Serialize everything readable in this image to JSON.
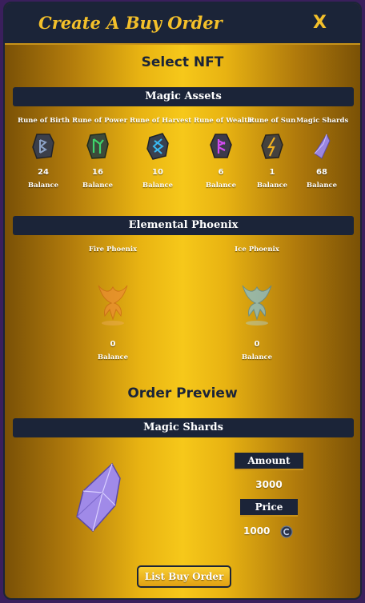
{
  "window": {
    "title": "Create A Buy Order",
    "close_label": "X"
  },
  "select_heading": "Select NFT",
  "magic_assets": {
    "title": "Magic Assets",
    "items": [
      {
        "label": "Rune of Birth",
        "count": "24",
        "balance": "Balance",
        "icon": "rune-of-birth-icon"
      },
      {
        "label": "Rune of Power",
        "count": "16",
        "balance": "Balance",
        "icon": "rune-of-power-icon"
      },
      {
        "label": "Rune of Harvest",
        "count": "10",
        "balance": "Balance",
        "icon": "rune-of-harvest-icon"
      },
      {
        "label": "Rune of Wealth",
        "count": "6",
        "balance": "Balance",
        "icon": "rune-of-wealth-icon"
      },
      {
        "label": "Rune of Sun",
        "count": "1",
        "balance": "Balance",
        "icon": "rune-of-sun-icon"
      },
      {
        "label": "Magic Shards",
        "count": "68",
        "balance": "Balance",
        "icon": "magic-shard-icon"
      }
    ]
  },
  "elemental_phoenix": {
    "title": "Elemental Phoenix",
    "items": [
      {
        "label": "Fire Phoenix",
        "count": "0",
        "balance": "Balance",
        "icon": "fire-phoenix-icon"
      },
      {
        "label": "Ice Phoenix",
        "count": "0",
        "balance": "Balance",
        "icon": "ice-phoenix-icon"
      }
    ]
  },
  "preview": {
    "heading": "Order Preview",
    "item_title": "Magic Shards",
    "amount_label": "Amount",
    "amount_value": "3000",
    "price_label": "Price",
    "price_value": "1000",
    "currency_icon": "coin-icon"
  },
  "submit_label": "List Buy Order",
  "colors": {
    "navy": "#1b2438",
    "gold": "#f4c02a"
  }
}
